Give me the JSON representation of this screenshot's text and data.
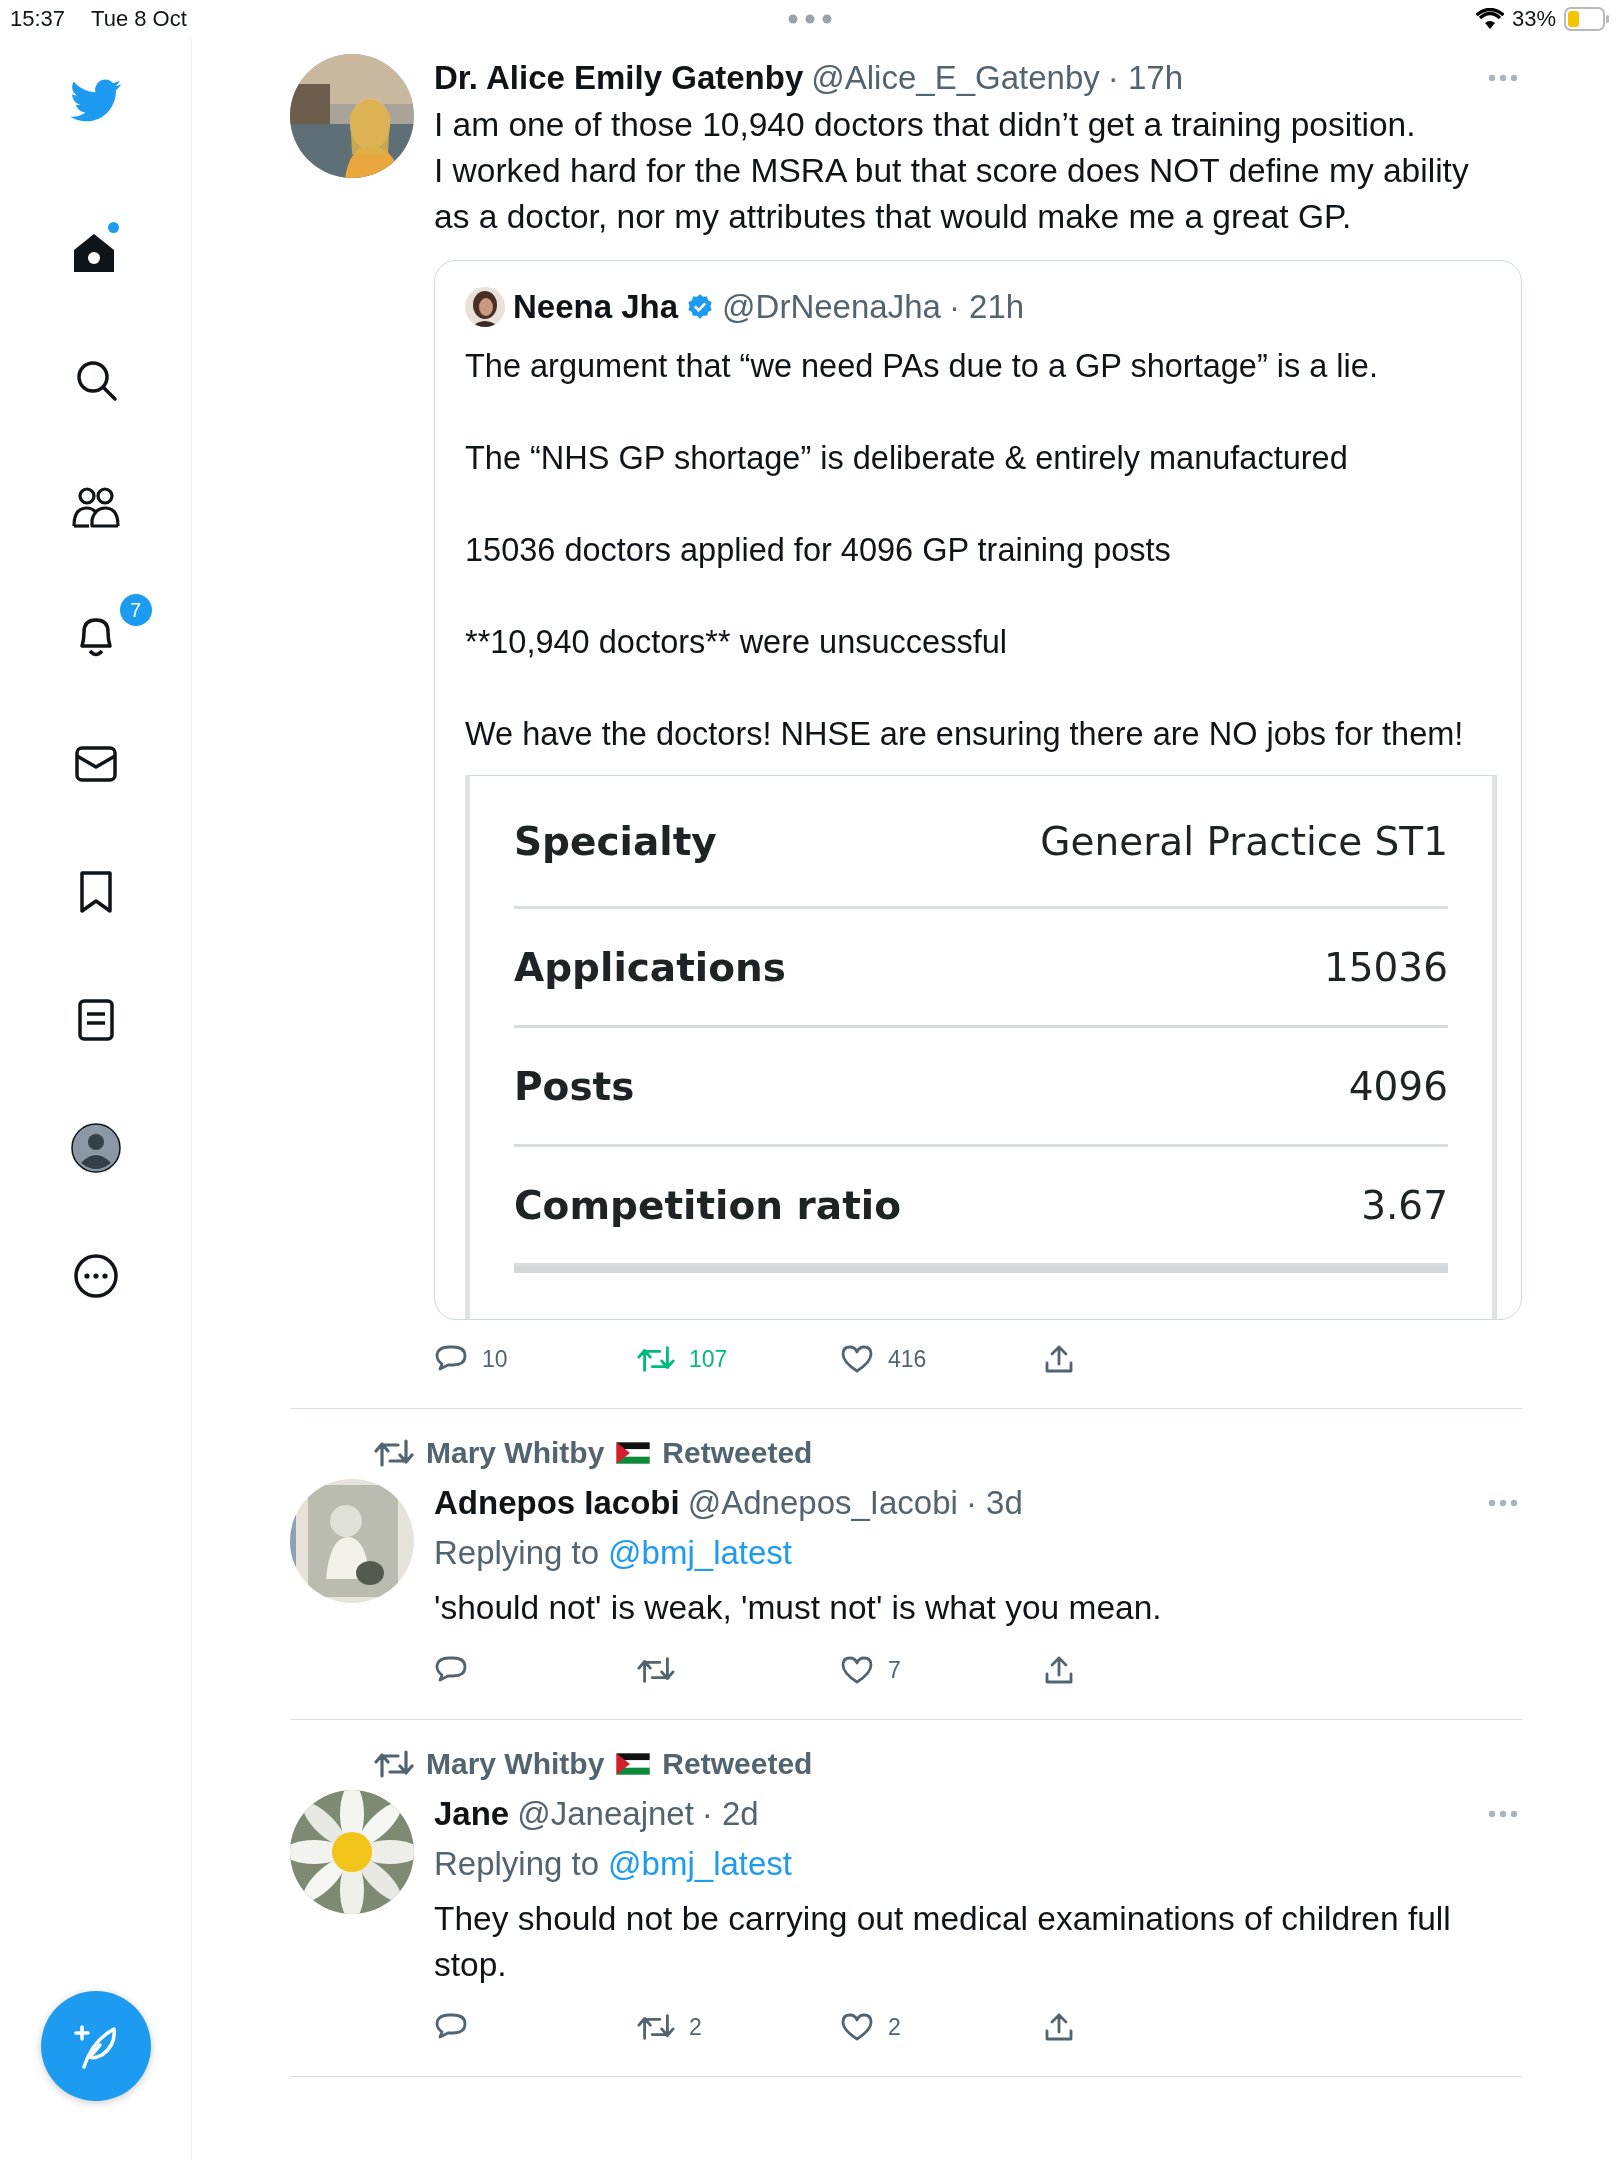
{
  "status_bar": {
    "time": "15:37",
    "date": "Tue 8 Oct",
    "battery": "33%"
  },
  "sidebar": {
    "items": [
      {
        "kind": "logo",
        "dot": false
      },
      {
        "kind": "home",
        "dot": true
      },
      {
        "kind": "search",
        "dot": false
      },
      {
        "kind": "communities",
        "dot": false
      },
      {
        "kind": "notifications",
        "dot": false,
        "badge": "7"
      },
      {
        "kind": "messages",
        "dot": false
      },
      {
        "kind": "bookmarks",
        "dot": false
      },
      {
        "kind": "lists",
        "dot": false
      },
      {
        "kind": "profile",
        "dot": false
      },
      {
        "kind": "more",
        "dot": false
      }
    ]
  },
  "tweets": [
    {
      "author": "Dr. Alice Emily Gatenby",
      "handle": "@Alice_E_Gatenby",
      "time": "· 17h",
      "paragraphs": [
        "I am one of those 10,940 doctors that didn’t get a training position.",
        "I worked hard for the MSRA but that score does NOT define my ability as a doctor, nor my attributes that would make me a great GP."
      ],
      "quote": {
        "author": "Neena Jha",
        "verified": true,
        "handle": "@DrNeenaJha",
        "time": "· 21h",
        "paragraphs": [
          "The argument that “we need PAs due to a GP shortage” is a lie.",
          "The “NHS GP shortage” is deliberate & entirely manufactured",
          "15036 doctors applied for 4096 GP training posts",
          "**10,940 doctors** were unsuccessful",
          "We have the doctors! NHSE are ensuring there are NO jobs for them!"
        ],
        "table": [
          {
            "label": "Specialty",
            "value": "General Practice ST1"
          },
          {
            "label": "Applications",
            "value": "15036"
          },
          {
            "label": "Posts",
            "value": "4096"
          },
          {
            "label": "Competition ratio",
            "value": "3.67"
          }
        ]
      },
      "actions": {
        "replies": "10",
        "retweets": "107",
        "retweeted": true,
        "likes": "416",
        "liked": false
      }
    },
    {
      "retweeted_by": "Mary Whitby",
      "retweet_label": "Retweeted",
      "author": "Adnepos Iacobi",
      "handle": "@Adnepos_Iacobi",
      "time": "· 3d",
      "replying_label": "Replying to",
      "replying_to": "@bmj_latest",
      "paragraphs": [
        "'should not' is weak, 'must not' is what you mean."
      ],
      "actions": {
        "likes": "7",
        "retweeted": false,
        "liked": false
      }
    },
    {
      "retweeted_by": "Mary Whitby",
      "retweet_label": "Retweeted",
      "author": "Jane",
      "handle": "@Janeajnet",
      "time": "· 2d",
      "replying_label": "Replying to",
      "replying_to": "@bmj_latest",
      "paragraphs": [
        "They should not be carrying out medical examinations of children full stop."
      ],
      "actions": {
        "retweets": "2",
        "likes": "2",
        "retweeted": false,
        "liked": false
      }
    }
  ]
}
